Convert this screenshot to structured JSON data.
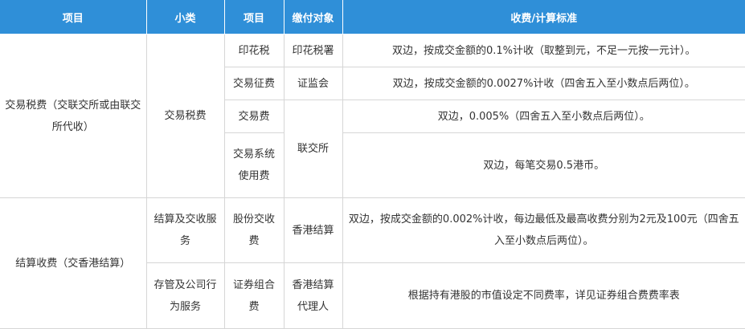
{
  "header": {
    "col1": "项目",
    "col2": "小类",
    "col3": "项目",
    "col4": "缴付对象",
    "col5": "收费/计算标准"
  },
  "groups": {
    "trading": {
      "category": "交易税费（交联交所或由联交所代收）",
      "subcategory": "交易税费",
      "items": [
        {
          "name": "印花税",
          "payee": "印花税署",
          "standard": "双边，按成交金额的0.1%计收（取整到元，不足一元按一元计）。"
        },
        {
          "name": "交易征费",
          "payee": "证监会",
          "standard": "双边，按成交金额的0.0027%计收（四舍五入至小数点后两位）。"
        },
        {
          "name": "交易费",
          "payee": "联交所",
          "standard": "双边，0.005%（四舍五入至小数点后两位）。"
        },
        {
          "name": "交易系统使用费",
          "standard": "双边，每笔交易0.5港币。"
        }
      ]
    },
    "settlement": {
      "category": "结算收费（交香港结算）",
      "items": [
        {
          "subcategory": "结算及交收服务",
          "name": "股份交收费",
          "payee": "香港结算",
          "standard": "双边，按成交金额的0.002%计收，每边最低及最高收费分别为2元及100元（四舍五入至小数点后两位）。"
        },
        {
          "subcategory": "存管及公司行为服务",
          "name": "证券组合费",
          "payee": "香港结算代理人",
          "standard": "根据持有港股的市值设定不同费率，详见证券组合费费率表"
        }
      ]
    }
  },
  "colors": {
    "header_bg": "#2f8fd8",
    "header_text": "#ffffff",
    "border": "#d6d6d6",
    "body_text": "#333333"
  }
}
